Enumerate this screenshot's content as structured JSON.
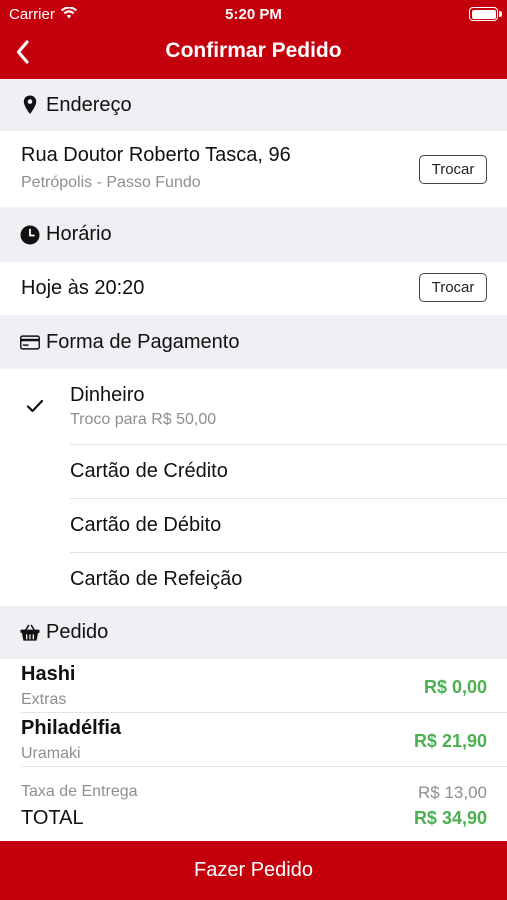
{
  "status_bar": {
    "carrier": "Carrier",
    "time": "5:20 PM"
  },
  "header": {
    "title": "Confirmar Pedido"
  },
  "address": {
    "section_title": "Endereço",
    "line1": "Rua Doutor Roberto Tasca, 96",
    "line2": "Petrópolis - Passo Fundo",
    "change_label": "Trocar"
  },
  "schedule": {
    "section_title": "Horário",
    "value": "Hoje às 20:20",
    "change_label": "Trocar"
  },
  "payment": {
    "section_title": "Forma de Pagamento",
    "selected": {
      "label": "Dinheiro",
      "sub": "Troco para R$ 50,00"
    },
    "options": [
      "Cartão de Crédito",
      "Cartão de Débito",
      "Cartão de Refeição"
    ]
  },
  "order": {
    "section_title": "Pedido",
    "items": [
      {
        "name": "Hashi",
        "sub": "Extras",
        "price": "R$ 0,00"
      },
      {
        "name": "Philadélfia",
        "sub": "Uramaki",
        "price": "R$ 21,90"
      }
    ],
    "delivery_label": "Taxa de Entrega",
    "delivery_value": "R$ 13,00",
    "total_label": "TOTAL",
    "total_value": "R$ 34,90"
  },
  "footer": {
    "submit_label": "Fazer Pedido"
  },
  "colors": {
    "brand_red": "#c4000c",
    "price_green": "#4cb050"
  }
}
